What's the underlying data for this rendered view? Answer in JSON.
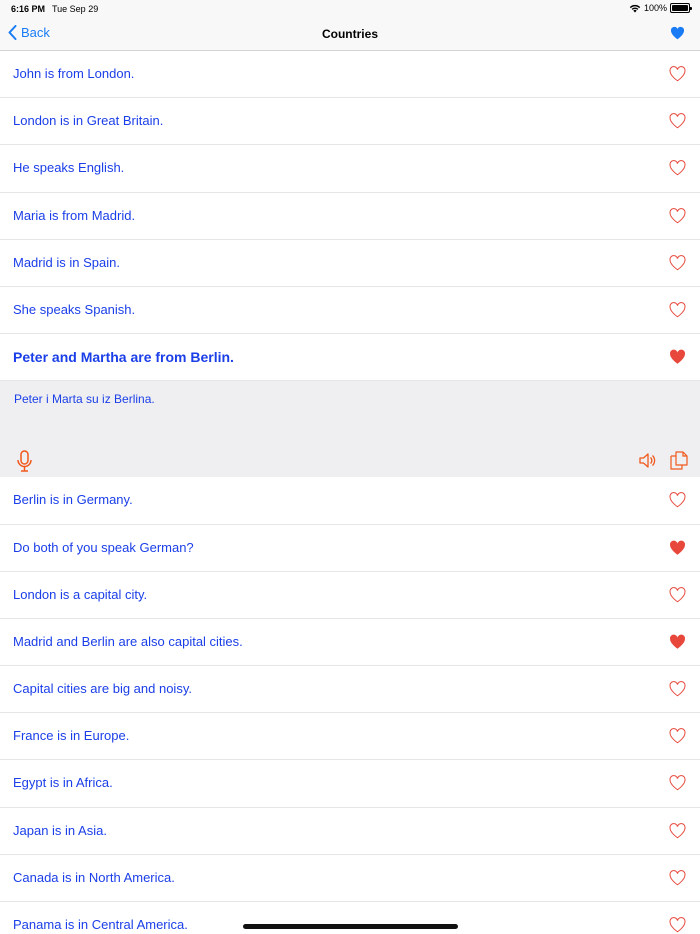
{
  "status": {
    "time": "6:16 PM",
    "date": "Tue Sep 29",
    "battery": "100%"
  },
  "nav": {
    "back_label": "Back",
    "title": "Countries"
  },
  "colors": {
    "accent": "#1a7cf5",
    "sentence": "#1a3ee8",
    "heart": "#e8483c",
    "icon_orange": "#f0581c"
  },
  "rows_top": [
    {
      "text": "John is from London.",
      "favorite": false
    },
    {
      "text": "London is in Great Britain.",
      "favorite": false
    },
    {
      "text": "He speaks English.",
      "favorite": false
    },
    {
      "text": "Maria is from Madrid.",
      "favorite": false
    },
    {
      "text": "Madrid is in Spain.",
      "favorite": false
    },
    {
      "text": "She speaks Spanish.",
      "favorite": false
    },
    {
      "text": "Peter and Martha are from Berlin.",
      "favorite": true,
      "selected": true
    }
  ],
  "panel": {
    "translation": "Peter i Marta su iz Berlina."
  },
  "rows_bottom": [
    {
      "text": "Berlin is in Germany.",
      "favorite": false
    },
    {
      "text": "Do both of you speak German?",
      "favorite": true
    },
    {
      "text": "London is a capital city.",
      "favorite": false
    },
    {
      "text": "Madrid and Berlin are also capital cities.",
      "favorite": true
    },
    {
      "text": "Capital cities are big and noisy.",
      "favorite": false
    },
    {
      "text": "France is in Europe.",
      "favorite": false
    },
    {
      "text": "Egypt is in Africa.",
      "favorite": false
    },
    {
      "text": "Japan is in Asia.",
      "favorite": false
    },
    {
      "text": "Canada is in North America.",
      "favorite": false
    },
    {
      "text": "Panama is in Central America.",
      "favorite": false
    }
  ]
}
